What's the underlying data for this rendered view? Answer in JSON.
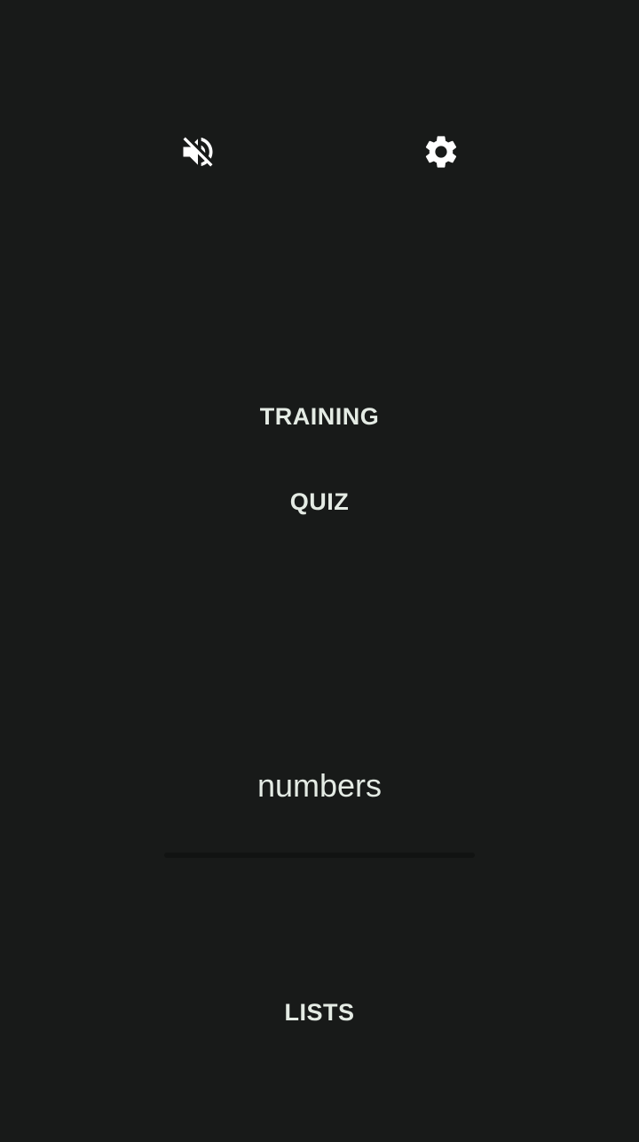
{
  "header": {
    "mute_icon": "volume-off-icon",
    "settings_icon": "gear-icon"
  },
  "menu": {
    "training_label": "TRAINING",
    "quiz_label": "QUIZ",
    "lists_label": "LISTS"
  },
  "selector": {
    "value": "numbers"
  },
  "colors": {
    "background": "#181a19",
    "text": "#e4ebe4",
    "icon": "#ffffff",
    "underline": "#111312"
  }
}
